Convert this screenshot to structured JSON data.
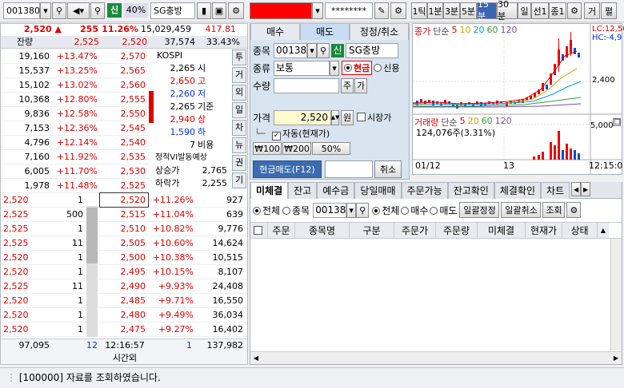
{
  "toolbar": {
    "code": "001380",
    "ratio": "40%",
    "name": "SG충방",
    "credit_badge": "신",
    "password": "********",
    "periods": [
      "1틱",
      "1분",
      "3분",
      "5분",
      "15분",
      "30분",
      "일",
      "선1",
      "종1"
    ],
    "active_period": "15분",
    "menu_label": "거",
    "pin_label": "펼"
  },
  "quote": {
    "price": "2,520",
    "change": "255",
    "rate": "11.26%",
    "volume": "15,029,459",
    "vol_extra": "417.81",
    "sub_labels": [
      "잔량",
      "2,525",
      "2,520",
      "37,574",
      "33.43%"
    ]
  },
  "ask": [
    {
      "qty": "19,160",
      "rate": "+13.47%",
      "price": "2,570"
    },
    {
      "qty": "15,537",
      "rate": "+13.25%",
      "price": "2,565"
    },
    {
      "qty": "15,102",
      "rate": "+13.02%",
      "price": "2,560"
    },
    {
      "qty": "10,368",
      "rate": "+12.80%",
      "price": "2,555"
    },
    {
      "qty": "9,836",
      "rate": "+12.58%",
      "price": "2,550"
    },
    {
      "qty": "7,153",
      "rate": "+12.36%",
      "price": "2,545"
    },
    {
      "qty": "4,796",
      "rate": "+12.14%",
      "price": "2,540"
    },
    {
      "qty": "7,160",
      "rate": "+11.92%",
      "price": "2,535"
    },
    {
      "qty": "6,005",
      "rate": "+11.70%",
      "price": "2,530"
    },
    {
      "qty": "1,978",
      "rate": "+11.48%",
      "price": "2,525"
    }
  ],
  "bid": [
    {
      "tp": "2,520",
      "tq": "1",
      "price": "2,520",
      "rate": "+11.26%",
      "qty": "927"
    },
    {
      "tp": "2,525",
      "tq": "500",
      "price": "2,515",
      "rate": "+11.04%",
      "qty": "639"
    },
    {
      "tp": "2,525",
      "tq": "1",
      "price": "2,510",
      "rate": "+10.82%",
      "qty": "9,776"
    },
    {
      "tp": "2,525",
      "tq": "11",
      "price": "2,505",
      "rate": "+10.60%",
      "qty": "14,624"
    },
    {
      "tp": "2,520",
      "tq": "1",
      "price": "2,500",
      "rate": "+10.38%",
      "qty": "10,515"
    },
    {
      "tp": "2,520",
      "tq": "1",
      "price": "2,495",
      "rate": "+10.15%",
      "qty": "8,107"
    },
    {
      "tp": "2,525",
      "tq": "11",
      "price": "2,490",
      "rate": "+9.93%",
      "qty": "24,408"
    },
    {
      "tp": "2,520",
      "tq": "1",
      "price": "2,485",
      "rate": "+9.71%",
      "qty": "16,550"
    },
    {
      "tp": "2,520",
      "tq": "1",
      "price": "2,480",
      "rate": "+9.49%",
      "qty": "36,034"
    },
    {
      "tp": "2,520",
      "tq": "1",
      "price": "2,475",
      "rate": "+9.27%",
      "qty": "16,402"
    }
  ],
  "info": {
    "title": "KOSPI",
    "rows": [
      {
        "v": "2,265",
        "k": "시",
        "c": "#000"
      },
      {
        "v": "2,650",
        "k": "고",
        "c": "#e00000"
      },
      {
        "v": "2,260",
        "k": "저",
        "c": "#0030e0"
      },
      {
        "v": "2,265",
        "k": "기준",
        "c": "#000"
      },
      {
        "v": "2,940",
        "k": "상",
        "c": "#e00000"
      },
      {
        "v": "1,590",
        "k": "하",
        "c": "#0030e0"
      },
      {
        "v": "7",
        "k": "비용",
        "c": "#000"
      }
    ],
    "vi": "정적VI발동예상",
    "upper_label": "상승가",
    "upper": "2,765",
    "lower_label": "하락가",
    "lower": "2,255"
  },
  "side_tabs": [
    "투",
    "거",
    "외",
    "일",
    "차",
    "뉴",
    "권",
    "기"
  ],
  "footer": {
    "ask_total": "97,095",
    "tick": "12",
    "time": "12:16:57",
    "session": "시간외",
    "one": "1",
    "bid_total": "137,982"
  },
  "order": {
    "tabs": [
      "매수",
      "매도",
      "정정/취소"
    ],
    "code_label": "종목",
    "code": "001380",
    "name": "SG충방",
    "type_label": "종류",
    "type": "보통",
    "cash": "현금",
    "credit": "신용",
    "qty_label": "수량",
    "unit_btn": "주",
    "add_btn": "가",
    "price_label": "가격",
    "price": "2,520",
    "won_btn": "원",
    "market_label": "시장가",
    "auto_label": "자동(현재가)",
    "amounts": [
      "₩100",
      "₩200",
      "50%"
    ],
    "submit": "현금매도(F12)",
    "cancel": "취소"
  },
  "chart": {
    "legend": [
      "종가",
      "단순",
      "5",
      "10",
      "20",
      "60",
      "120"
    ],
    "lc": "LC:12,50",
    "hc": "HC:-4,9",
    "y_mid": "2,400",
    "vol_legend": [
      "거래량",
      "단순",
      "5",
      "20",
      "60",
      "120"
    ],
    "vol_text": "124,076주(3.31%)",
    "vol_axis": "5,000",
    "x_labels": [
      "01/12",
      "13",
      "12:15:0"
    ],
    "colors": {
      "ma5": "#e00000",
      "ma10": "#e0a000",
      "ma20": "#00a0e0"
    }
  },
  "bottom": {
    "tabs": [
      "미체결",
      "잔고",
      "예수금",
      "당일매매",
      "주문가능",
      "잔고확인",
      "체결확인",
      "차트"
    ],
    "all": "전체",
    "by_code": "종목",
    "code": "001380",
    "all2": "전체",
    "buy": "매수",
    "sell": "매도",
    "batch_fix": "일괄정정",
    "batch_cancel": "일괄취소",
    "query": "조회",
    "cols": [
      "주문",
      "종목명",
      "구분",
      "주문가",
      "주문량",
      "미체결",
      "현재가",
      "상태"
    ]
  },
  "status": {
    "message": "[100000] 자료를 조회하였습니다."
  }
}
